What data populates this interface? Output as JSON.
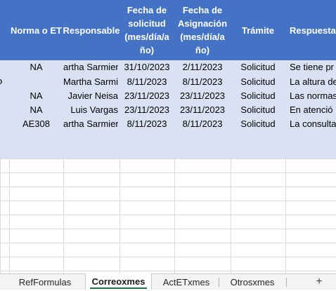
{
  "header": {
    "norma": "Norma o ET",
    "responsable": "Responsable",
    "fecha_solicitud": "Fecha de\nsolicitud\n(mes/día/a\nño)",
    "fecha_asignacion": "Fecha de\nAsignación\n(mes/día/a\nño)",
    "tramite": "Trámite",
    "respuesta": "Respuesta"
  },
  "left_marker": "o",
  "rows": [
    {
      "norma": "NA",
      "responsable": "artha Sarmier",
      "fecha_solicitud": "31/10/2023",
      "fecha_asignacion": "2/11/2023",
      "tramite": "Solicitud",
      "respuesta": "Se tiene pr"
    },
    {
      "norma": "",
      "responsable": "Martha Sarmier",
      "fecha_solicitud": "8/11/2023",
      "fecha_asignacion": "8/11/2023",
      "tramite": "Solicitud",
      "respuesta": "La altura de"
    },
    {
      "norma": "NA",
      "responsable": "Javier Neisa",
      "fecha_solicitud": "23/11/2023",
      "fecha_asignacion": "23/11/2023",
      "tramite": "Solicitud",
      "respuesta": "Las normas"
    },
    {
      "norma": "NA",
      "responsable": "Luis Vargas",
      "fecha_solicitud": "23/11/2023",
      "fecha_asignacion": "23/11/2023",
      "tramite": "Solicitud",
      "respuesta": "En atenció"
    },
    {
      "norma": "AE308",
      "responsable": "artha Sarmier",
      "fecha_solicitud": "8/11/2023",
      "fecha_asignacion": "8/11/2023",
      "tramite": "Solicitud",
      "respuesta": "La consulta"
    }
  ],
  "tabs": [
    {
      "label": "RefFormulas",
      "active": false
    },
    {
      "label": "Correoxmes",
      "active": true
    },
    {
      "label": "ActETxmes",
      "active": false
    },
    {
      "label": "Otrosxmes",
      "active": false
    }
  ],
  "add_sheet": "+"
}
